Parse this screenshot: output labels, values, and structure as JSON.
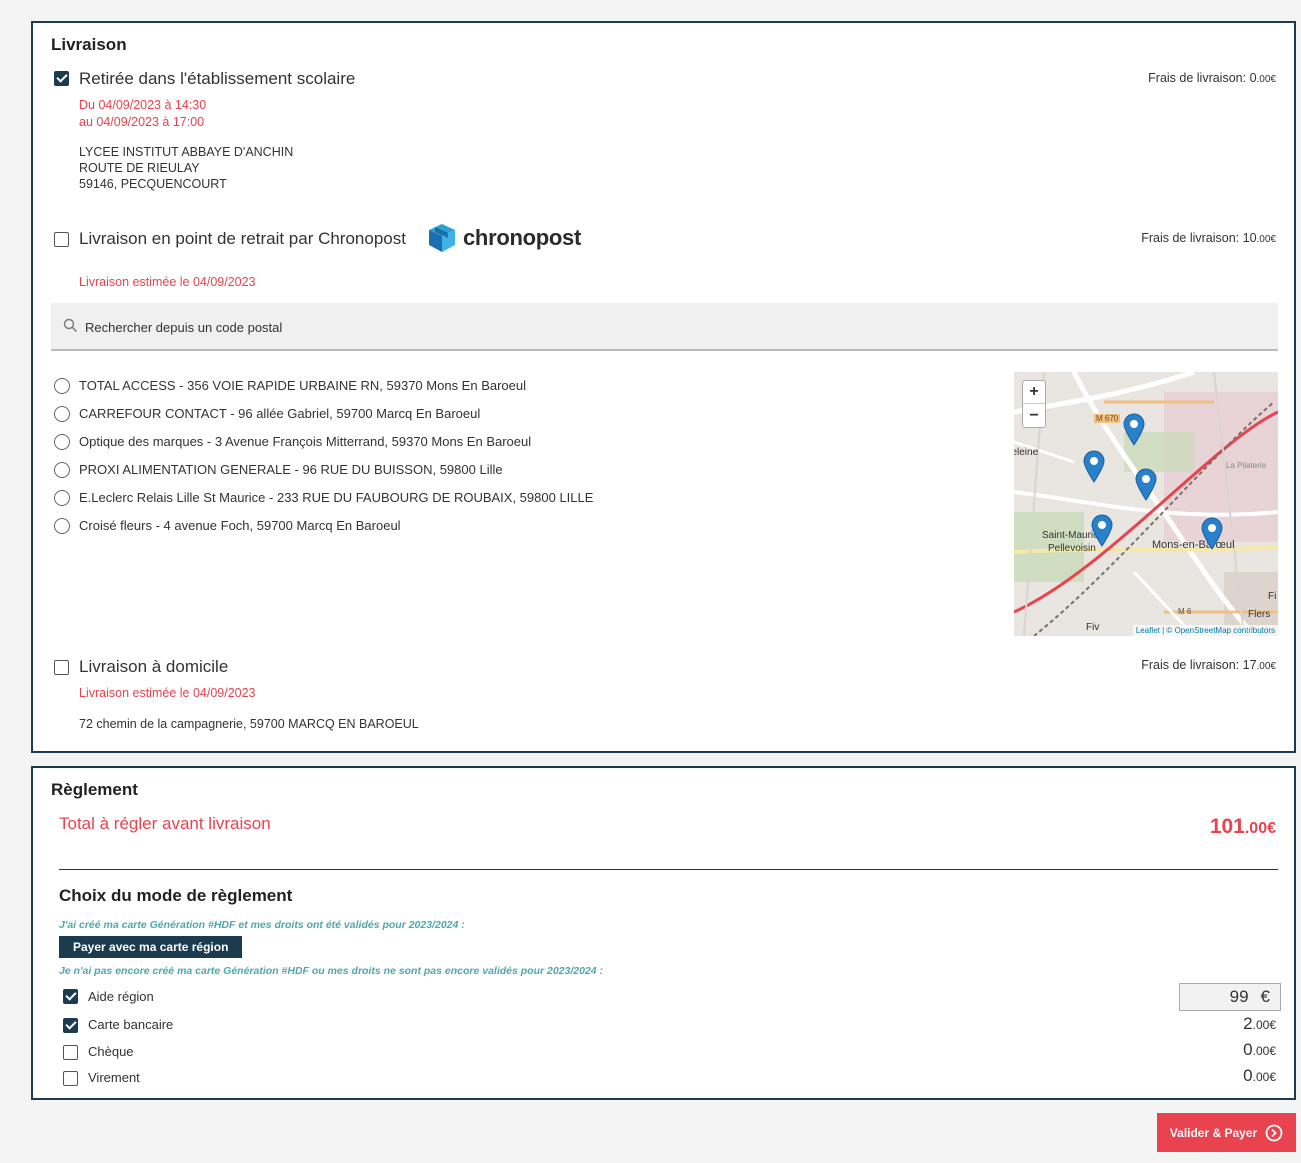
{
  "livraison": {
    "title": "Livraison",
    "options": [
      {
        "label": "Retirée dans l'établissement scolaire",
        "checked": true,
        "fee_label": "Frais de livraison: ",
        "fee_units": "0",
        "fee_cents": ".00€",
        "date_from": "Du 04/09/2023 à 14:30",
        "date_to": "au 04/09/2023 à 17:00",
        "address": [
          "LYCEE INSTITUT ABBAYE D'ANCHIN",
          "ROUTE DE RIEULAY",
          "59146, PECQUENCOURT"
        ]
      },
      {
        "label": "Livraison en point de retrait par Chronopost",
        "checked": false,
        "brand": "chronopost",
        "brand_icon": "chronopost-box-icon",
        "fee_label": "Frais de livraison: ",
        "fee_units": "10",
        "fee_cents": ".00€",
        "estimate": "Livraison estimée le 04/09/2023"
      },
      {
        "label": "Livraison à domicile",
        "checked": false,
        "fee_label": "Frais de livraison: ",
        "fee_units": "17",
        "fee_cents": ".00€",
        "estimate": "Livraison estimée le 04/09/2023",
        "address": "72 chemin de la campagnerie, 59700 MARCQ EN BAROEUL"
      }
    ],
    "search": {
      "placeholder": "Rechercher depuis un code postal",
      "icon": "search-icon"
    },
    "relay_points": [
      "TOTAL ACCESS - 356 VOIE RAPIDE URBAINE RN, 59370 Mons En Baroeul",
      "CARREFOUR CONTACT - 96 allée Gabriel, 59700 Marcq En Baroeul",
      "Optique des marques - 3 Avenue François Mitterrand, 59370 Mons En Baroeul",
      "PROXI ALIMENTATION GENERALE - 96 RUE DU BUISSON, 59800 Lille",
      "E.Leclerc Relais Lille St Maurice - 233 RUE DU FAUBOURG DE ROUBAIX, 59800 LILLE",
      "Croisé fleurs - 4 avenue Foch, 59700 Marcq En Baroeul"
    ],
    "map": {
      "zoom_in": "+",
      "zoom_out": "−",
      "labels": {
        "road_m670": "M 670",
        "la_pilaterie": "La Pilaterie",
        "madeleine": "Madeleine",
        "saint_maurice": "Saint-Maurice",
        "pellevoisin": "Pellevoisin",
        "mons": "Mons-en-Barœul",
        "m6": "M 6",
        "flers": "Flers",
        "fi": "Fi",
        "fiv": "Fiv"
      },
      "attribution": "Leaflet | © OpenStreetMap contributors",
      "marker_count": 5,
      "colors": {
        "marker": "#2a81cb",
        "rail": "#e8434f",
        "green": "#c8dcb8",
        "pink": "#e8c8d0"
      }
    }
  },
  "reglement": {
    "title": "Règlement",
    "total_label": "Total à régler avant livraison",
    "total_units": "101",
    "total_cents": ".00€",
    "mode_title": "Choix du mode de règlement",
    "help_have_card": "J'ai créé ma carte Génération #HDF et mes droits ont été validés pour 2023/2024 :",
    "pay_card_button": "Payer avec ma carte région",
    "help_no_card": "Je n'ai pas encore créé ma carte Génération #HDF ou mes droits ne sont pas encore validés pour 2023/2024 :",
    "methods": [
      {
        "label": "Aide région",
        "checked": true,
        "input_value": "99",
        "currency": "€"
      },
      {
        "label": "Carte bancaire",
        "checked": true,
        "units": "2",
        "cents": ".00€"
      },
      {
        "label": "Chèque",
        "checked": false,
        "units": "0",
        "cents": ".00€"
      },
      {
        "label": "Virement",
        "checked": false,
        "units": "0",
        "cents": ".00€"
      }
    ]
  },
  "submit": {
    "label": "Valider & Payer",
    "icon": "chevron-circle-right-icon"
  },
  "colors": {
    "primary_dark": "#1b3b4f",
    "accent_red": "#e8434f",
    "help_teal": "#4fa7a9"
  }
}
